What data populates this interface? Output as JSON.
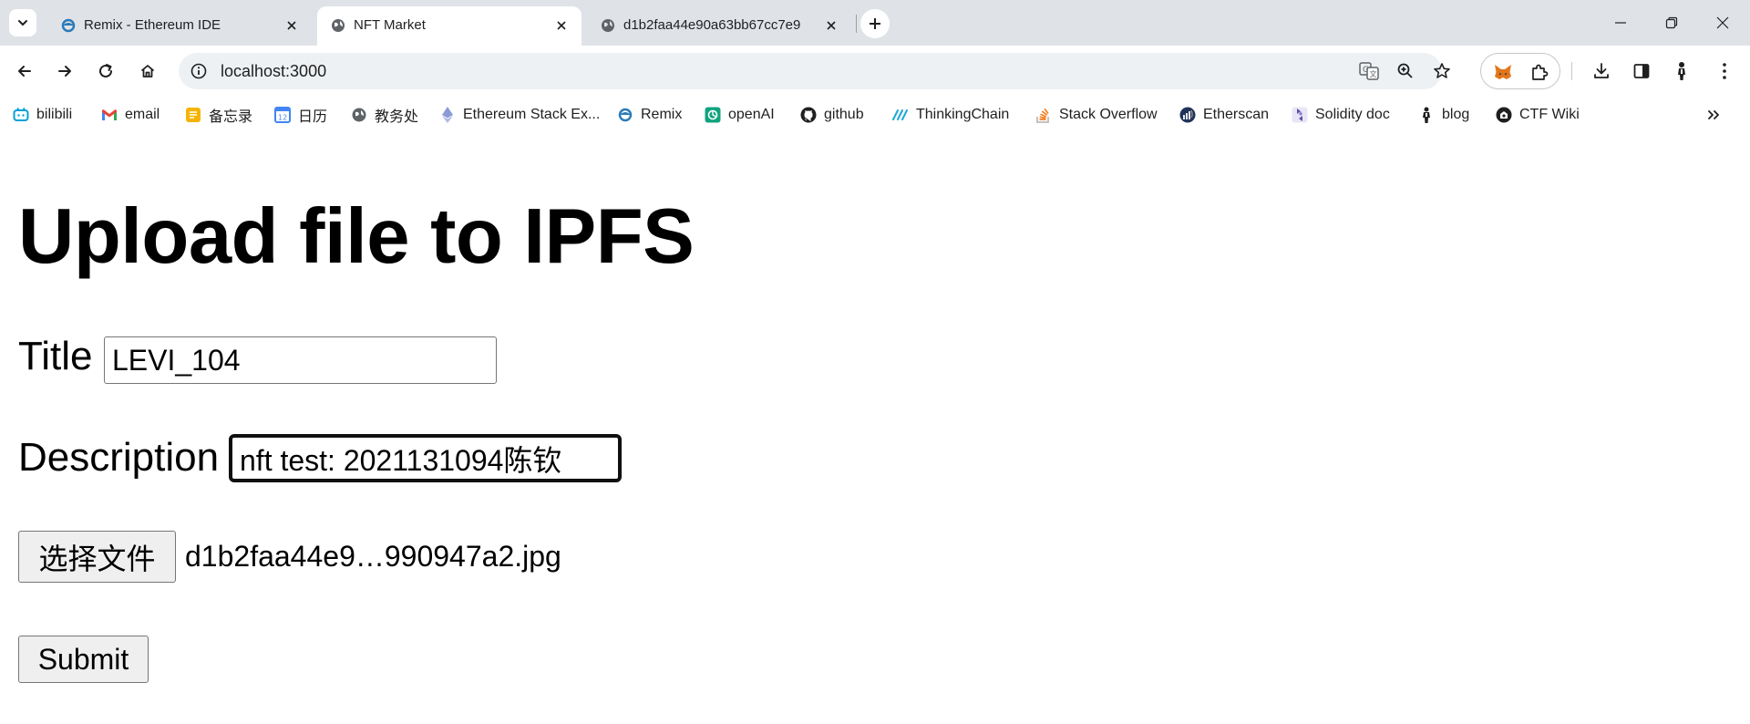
{
  "browser": {
    "tabs": [
      {
        "title": "Remix - Ethereum IDE",
        "icon": "remix-icon",
        "active": false
      },
      {
        "title": "NFT Market",
        "icon": "globe-icon",
        "active": true
      },
      {
        "title": "d1b2faa44e90a63bb67cc7e9",
        "icon": "globe-icon",
        "active": false
      }
    ],
    "address_bar": {
      "url": "localhost:3000"
    },
    "bookmarks": [
      {
        "label": "bilibili",
        "icon": "bilibili-icon",
        "color": "#00a1d6"
      },
      {
        "label": "email",
        "icon": "gmail-icon",
        "color": "#ea4335"
      },
      {
        "label": "备忘录",
        "icon": "notes-icon",
        "color": "#f4b400"
      },
      {
        "label": "日历",
        "icon": "calendar-icon",
        "color": "#4285f4"
      },
      {
        "label": "教务处",
        "icon": "globe-icon",
        "color": "#5f6368"
      },
      {
        "label": "Ethereum Stack Ex...",
        "icon": "ethereum-icon",
        "color": "#7b8ccf"
      },
      {
        "label": "Remix",
        "icon": "remix-icon",
        "color": "#2a7ab8"
      },
      {
        "label": "openAI",
        "icon": "openai-icon",
        "color": "#10a37f"
      },
      {
        "label": "github",
        "icon": "github-icon",
        "color": "#1f1f1f"
      },
      {
        "label": "ThinkingChain",
        "icon": "thinkingchain-icon",
        "color": "#1aa7d8"
      },
      {
        "label": "Stack Overflow",
        "icon": "stackoverflow-icon",
        "color": "#f48024"
      },
      {
        "label": "Etherscan",
        "icon": "etherscan-icon",
        "color": "#21325b"
      },
      {
        "label": "Solidity doc",
        "icon": "solidity-icon",
        "color": "#5b4fa8"
      },
      {
        "label": "blog",
        "icon": "blog-icon",
        "color": "#1f1f1f"
      },
      {
        "label": "CTF Wiki",
        "icon": "ctfwiki-icon",
        "color": "#1f1f1f"
      }
    ]
  },
  "page": {
    "title": "Upload file to IPFS",
    "form": {
      "title_label": "Title",
      "title_value": "LEVI_104",
      "description_label": "Description",
      "description_value": "nft test: 2021131094陈钦",
      "file_button_label": "选择文件",
      "file_name": "d1b2faa44e9…990947a2.jpg",
      "submit_label": "Submit"
    }
  }
}
